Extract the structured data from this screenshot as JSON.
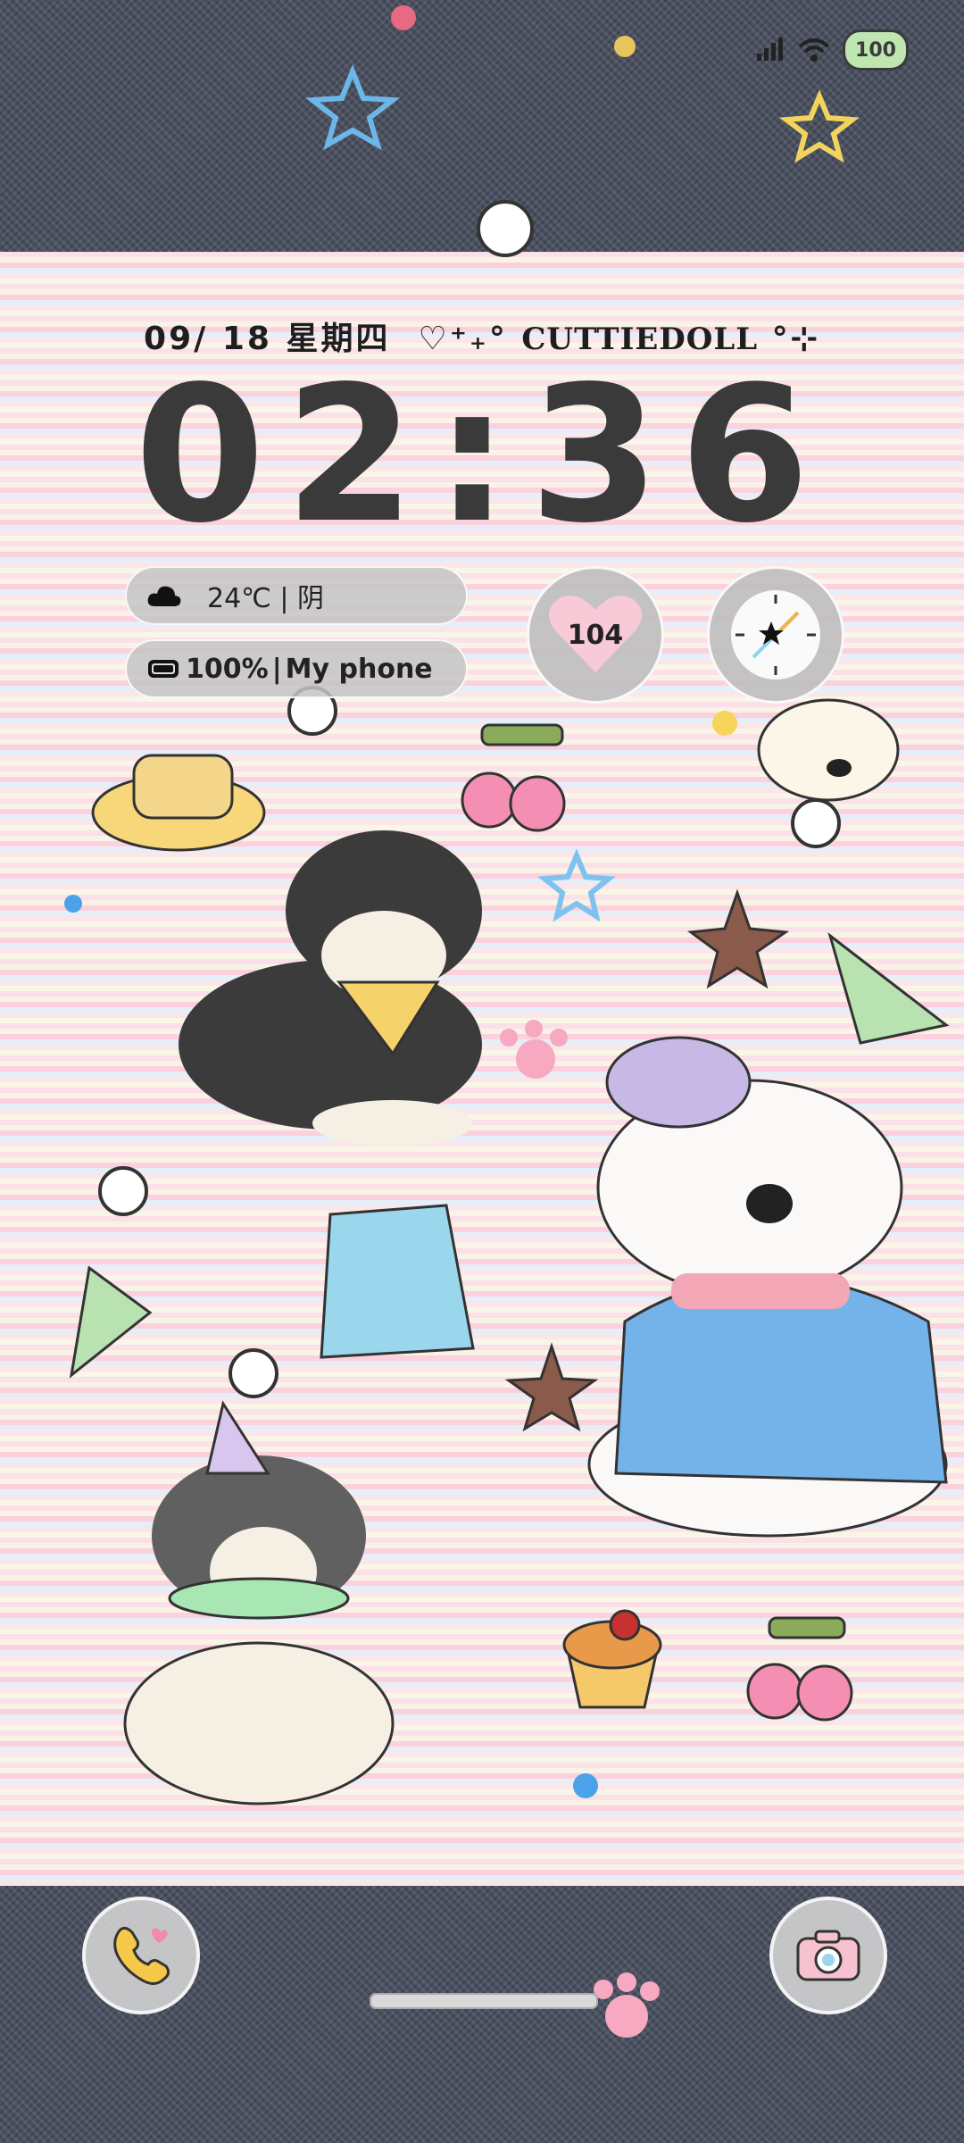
{
  "status_bar": {
    "battery_level": "100",
    "icons": [
      "signal-icon",
      "wifi-icon",
      "battery-icon"
    ]
  },
  "lockscreen": {
    "date": "09/ 18 星期四",
    "brand_deco_left": "♡⁺₊°",
    "brand": "CUTTIEDOLL",
    "brand_deco_right": "°⊹",
    "time": "02:36"
  },
  "widgets": {
    "weather": {
      "icon": "cloud-icon",
      "text": "24℃ | 阴"
    },
    "device": {
      "battery_text": "100%",
      "separator": "|",
      "name": "My phone"
    },
    "heart": {
      "value": "104"
    },
    "compass": {
      "icon": "compass-icon"
    }
  },
  "shortcuts": {
    "left": "phone-icon",
    "right": "camera-icon"
  },
  "colors": {
    "denim": "#4a5060",
    "clock": "#3a3a3a",
    "pill": "#c4c4c4",
    "heart": "#f8c9d6"
  }
}
